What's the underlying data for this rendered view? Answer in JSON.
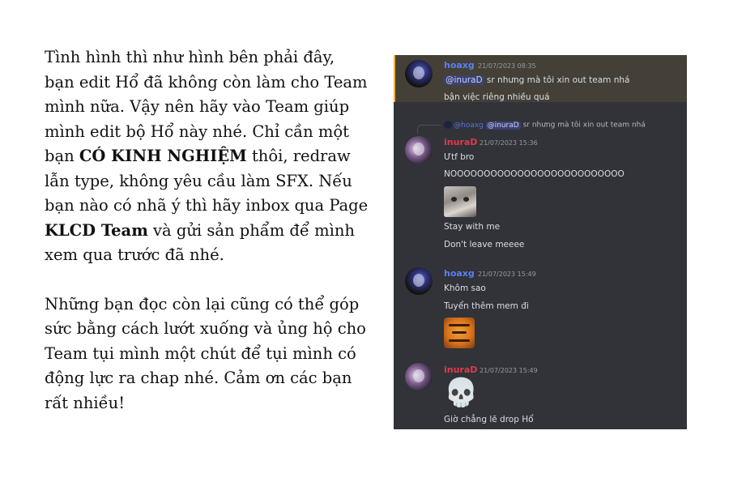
{
  "left": {
    "p1_a": "Tình hình thì như hình bên phải đây, bạn edit Hổ đã không còn làm cho Team mình nữa. Vậy nên hãy vào Team giúp mình edit bộ Hổ này nhé. Chỉ cần một bạn ",
    "p1_b": "CÓ KINH NGHIỆM",
    "p1_c": " thôi, redraw lẫn type, không yêu cầu làm SFX. Nếu bạn nào có nhã ý thì hãy inbox qua Page ",
    "p1_d": "KLCD Team",
    "p1_e": " và gửi sản phẩm để mình xem qua trước đã nhé.",
    "p2": "Những bạn đọc còn lại cũng có thể góp sức bằng cách lướt xuống và ủng hộ cho Team tụi mình một chút để tụi mình có động lực ra chap nhé. Cảm ơn các bạn rất nhiều!"
  },
  "chat": {
    "m1": {
      "user": "hoaxg",
      "time": "21/07/2023 08:35",
      "mention": "@inuraD",
      "line1_rest": " sr nhưng mà tôi xin out team nhá",
      "line2": "bận việc riêng nhiều quá"
    },
    "reply": {
      "user": "@hoaxg",
      "mention": "@inuraD",
      "text": " sr nhưng mà tôi xin out team nhá"
    },
    "m2": {
      "user": "inuraD",
      "time": "21/07/2023 15:36",
      "line1": "Ưtf bro",
      "line2": "NOOOOOOOOOOOOOOOOOOOOOOOOOO",
      "line3": "Stay with me",
      "line4": "Don't leave meeee"
    },
    "m3": {
      "user": "hoaxg",
      "time": "21/07/2023 15:49",
      "line1": "Khôm sao",
      "line2": "Tuyển thêm mem đi"
    },
    "m4": {
      "user": "inuraD",
      "time": "21/07/2023 15:49",
      "emoji": "💀",
      "line1": "Giờ chẳng lẽ drop Hổ"
    }
  }
}
